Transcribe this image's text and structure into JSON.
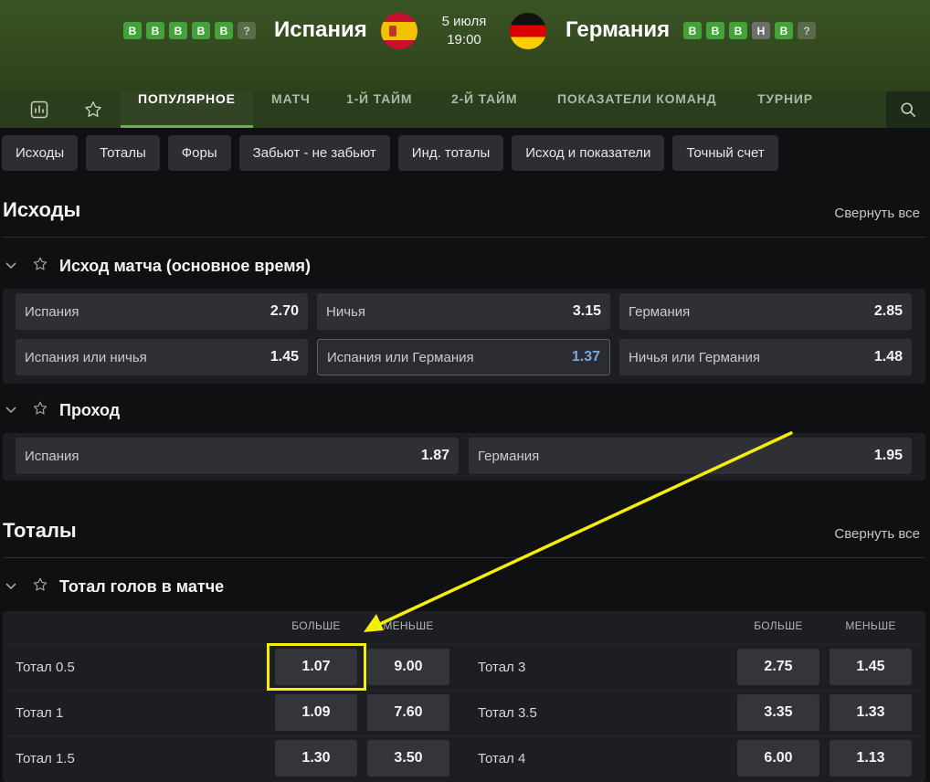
{
  "match": {
    "home": {
      "name": "Испания",
      "form": [
        "В",
        "В",
        "В",
        "В",
        "В",
        "?"
      ]
    },
    "away": {
      "name": "Германия",
      "form": [
        "В",
        "В",
        "В",
        "Н",
        "В",
        "?"
      ]
    },
    "date": "5 июля",
    "time": "19:00"
  },
  "tabs": [
    "ПОПУЛЯРНОЕ",
    "МАТЧ",
    "1-Й ТАЙМ",
    "2-Й ТАЙМ",
    "ПОКАЗАТЕЛИ КОМАНД",
    "ТУРНИР"
  ],
  "active_tab": "ПОПУЛЯРНОЕ",
  "filters": [
    "Исходы",
    "Тоталы",
    "Форы",
    "Забьют - не забьют",
    "Инд. тоталы",
    "Исход и показатели",
    "Точный счет"
  ],
  "sections": {
    "outcomes": {
      "title": "Исходы",
      "collapse": "Свернуть все",
      "match_result": {
        "title": "Исход матча (основное время)",
        "odds": [
          {
            "label": "Испания",
            "value": "2.70"
          },
          {
            "label": "Ничья",
            "value": "3.15"
          },
          {
            "label": "Германия",
            "value": "2.85"
          },
          {
            "label": "Испания или ничья",
            "value": "1.45"
          },
          {
            "label": "Испания или Германия",
            "value": "1.37"
          },
          {
            "label": "Ничья или Германия",
            "value": "1.48"
          }
        ]
      },
      "qualify": {
        "title": "Проход",
        "odds": [
          {
            "label": "Испания",
            "value": "1.87"
          },
          {
            "label": "Германия",
            "value": "1.95"
          }
        ]
      }
    },
    "totals": {
      "title": "Тоталы",
      "collapse": "Свернуть все",
      "goals": {
        "title": "Тотал голов в матче",
        "over_label": "БОЛЬШЕ",
        "under_label": "МЕНЬШЕ",
        "left": [
          {
            "label": "Тотал 0.5",
            "over": "1.07",
            "under": "9.00"
          },
          {
            "label": "Тотал 1",
            "over": "1.09",
            "under": "7.60"
          },
          {
            "label": "Тотал 1.5",
            "over": "1.30",
            "under": "3.50"
          }
        ],
        "right": [
          {
            "label": "Тотал 3",
            "over": "2.75",
            "under": "1.45"
          },
          {
            "label": "Тотал 3.5",
            "over": "3.35",
            "under": "1.33"
          },
          {
            "label": "Тотал 4",
            "over": "6.00",
            "under": "1.13"
          }
        ]
      }
    }
  },
  "annotation": {
    "color": "#f5ee0a",
    "target": "Тотал 0.5 — БОЛЬШЕ"
  }
}
